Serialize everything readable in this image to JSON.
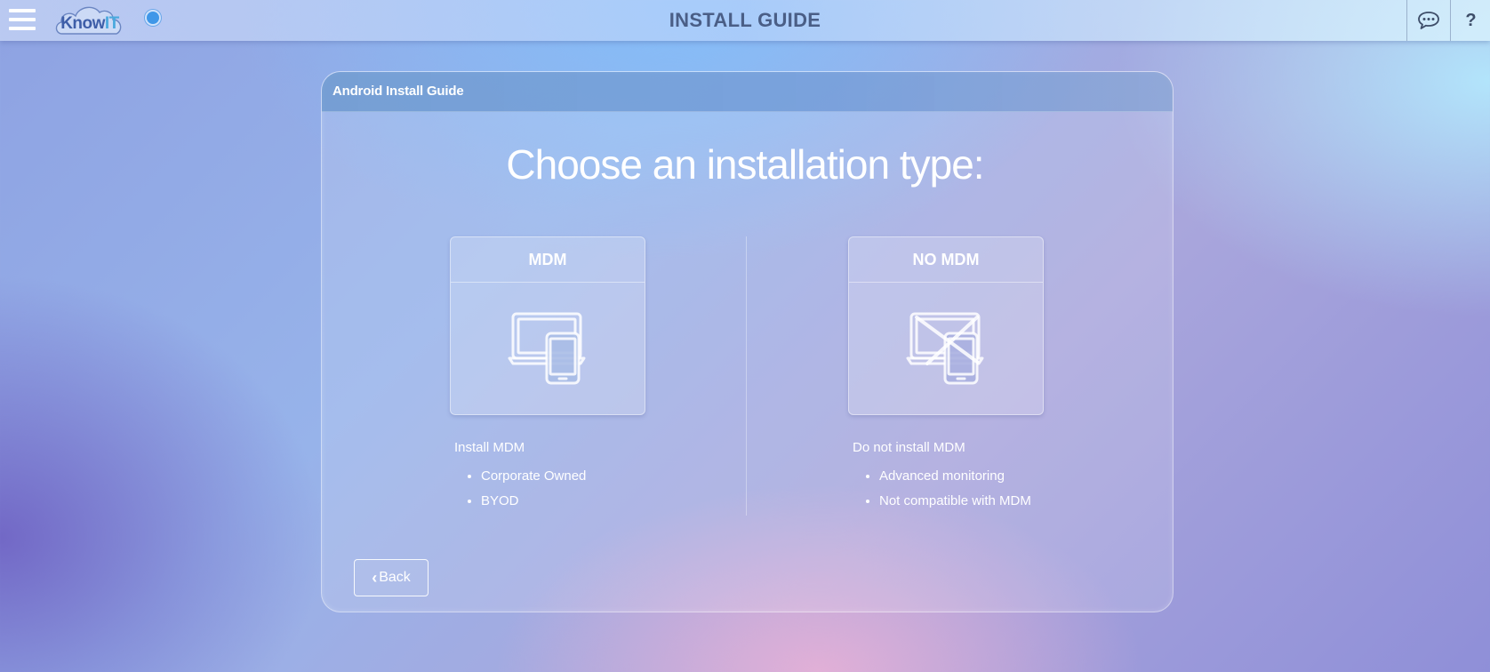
{
  "header": {
    "title": "INSTALL GUIDE",
    "logo": {
      "prefix": "Know",
      "suffix": "IT"
    }
  },
  "card": {
    "title": "Android Install Guide",
    "heading": "Choose an installation type:"
  },
  "options": [
    {
      "title": "MDM",
      "description": "Install MDM",
      "bullets": [
        "Corporate Owned",
        "BYOD"
      ],
      "icon": "devices-icon"
    },
    {
      "title": "NO MDM",
      "description": "Do not install MDM",
      "bullets": [
        "Advanced monitoring",
        "Not compatible with MDM"
      ],
      "icon": "devices-crossed-icon"
    }
  ],
  "back_label": "Back",
  "colors": {
    "header_text": "#4a5e86",
    "status_dot": "#3f97e8",
    "logo_blue": "#3e5ea8",
    "logo_accent": "#4aa9de"
  }
}
